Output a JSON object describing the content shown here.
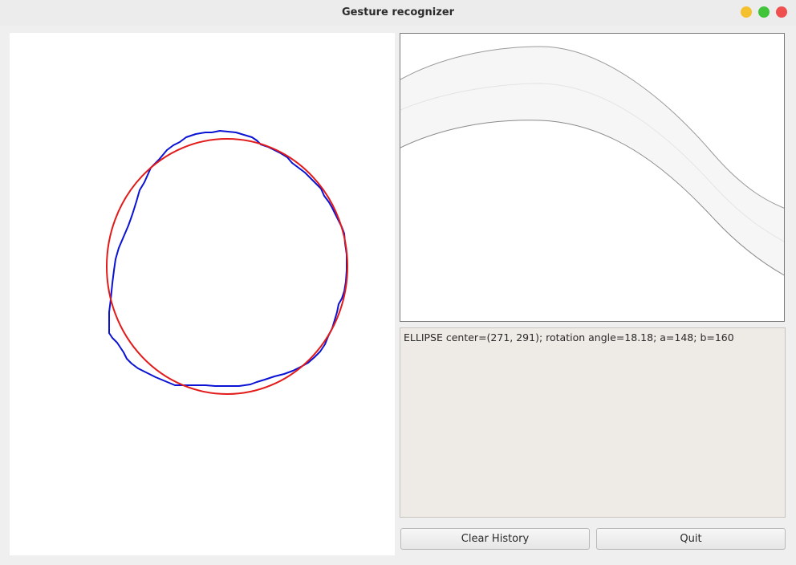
{
  "window": {
    "title": "Gesture recognizer"
  },
  "output": {
    "text": "ELLIPSE center=(271, 291); rotation angle=18.18; a=148; b=160"
  },
  "buttons": {
    "clear_history": "Clear History",
    "quit": "Quit"
  },
  "colors": {
    "stroke": "#0a12d4",
    "fitted_ellipse": "#e21a1a",
    "window_controls": [
      "#f5c02d",
      "#3fc43a",
      "#ef4f4f"
    ]
  }
}
